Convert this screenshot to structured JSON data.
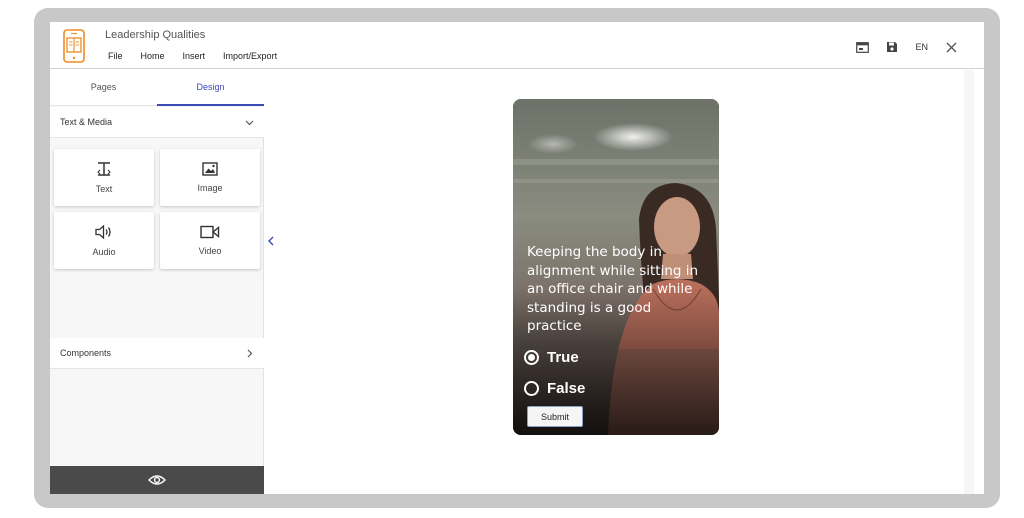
{
  "app": {
    "title": "Leadership Qualities",
    "menu": [
      "File",
      "Home",
      "Insert",
      "Import/Export"
    ],
    "language": "EN"
  },
  "sidebar": {
    "tabs": [
      {
        "label": "Pages"
      },
      {
        "label": "Design"
      }
    ],
    "active_tab": "Design",
    "section_text_media": "Text & Media",
    "tiles": [
      {
        "label": "Text",
        "icon": "text-icon"
      },
      {
        "label": "Image",
        "icon": "image-icon"
      },
      {
        "label": "Audio",
        "icon": "audio-icon"
      },
      {
        "label": "Video",
        "icon": "video-icon"
      }
    ],
    "section_components": "Components"
  },
  "card": {
    "question": "Keeping the body in alignment while sitting in an office chair and while standing is a good practice",
    "options": [
      {
        "label": "True",
        "selected": true
      },
      {
        "label": "False",
        "selected": false
      }
    ],
    "submit_label": "Submit"
  },
  "colors": {
    "accent": "#3a4bb5",
    "preview_bar": "#4a4a4a",
    "frame": "#c8c8c8",
    "logo": "#f08a24"
  }
}
